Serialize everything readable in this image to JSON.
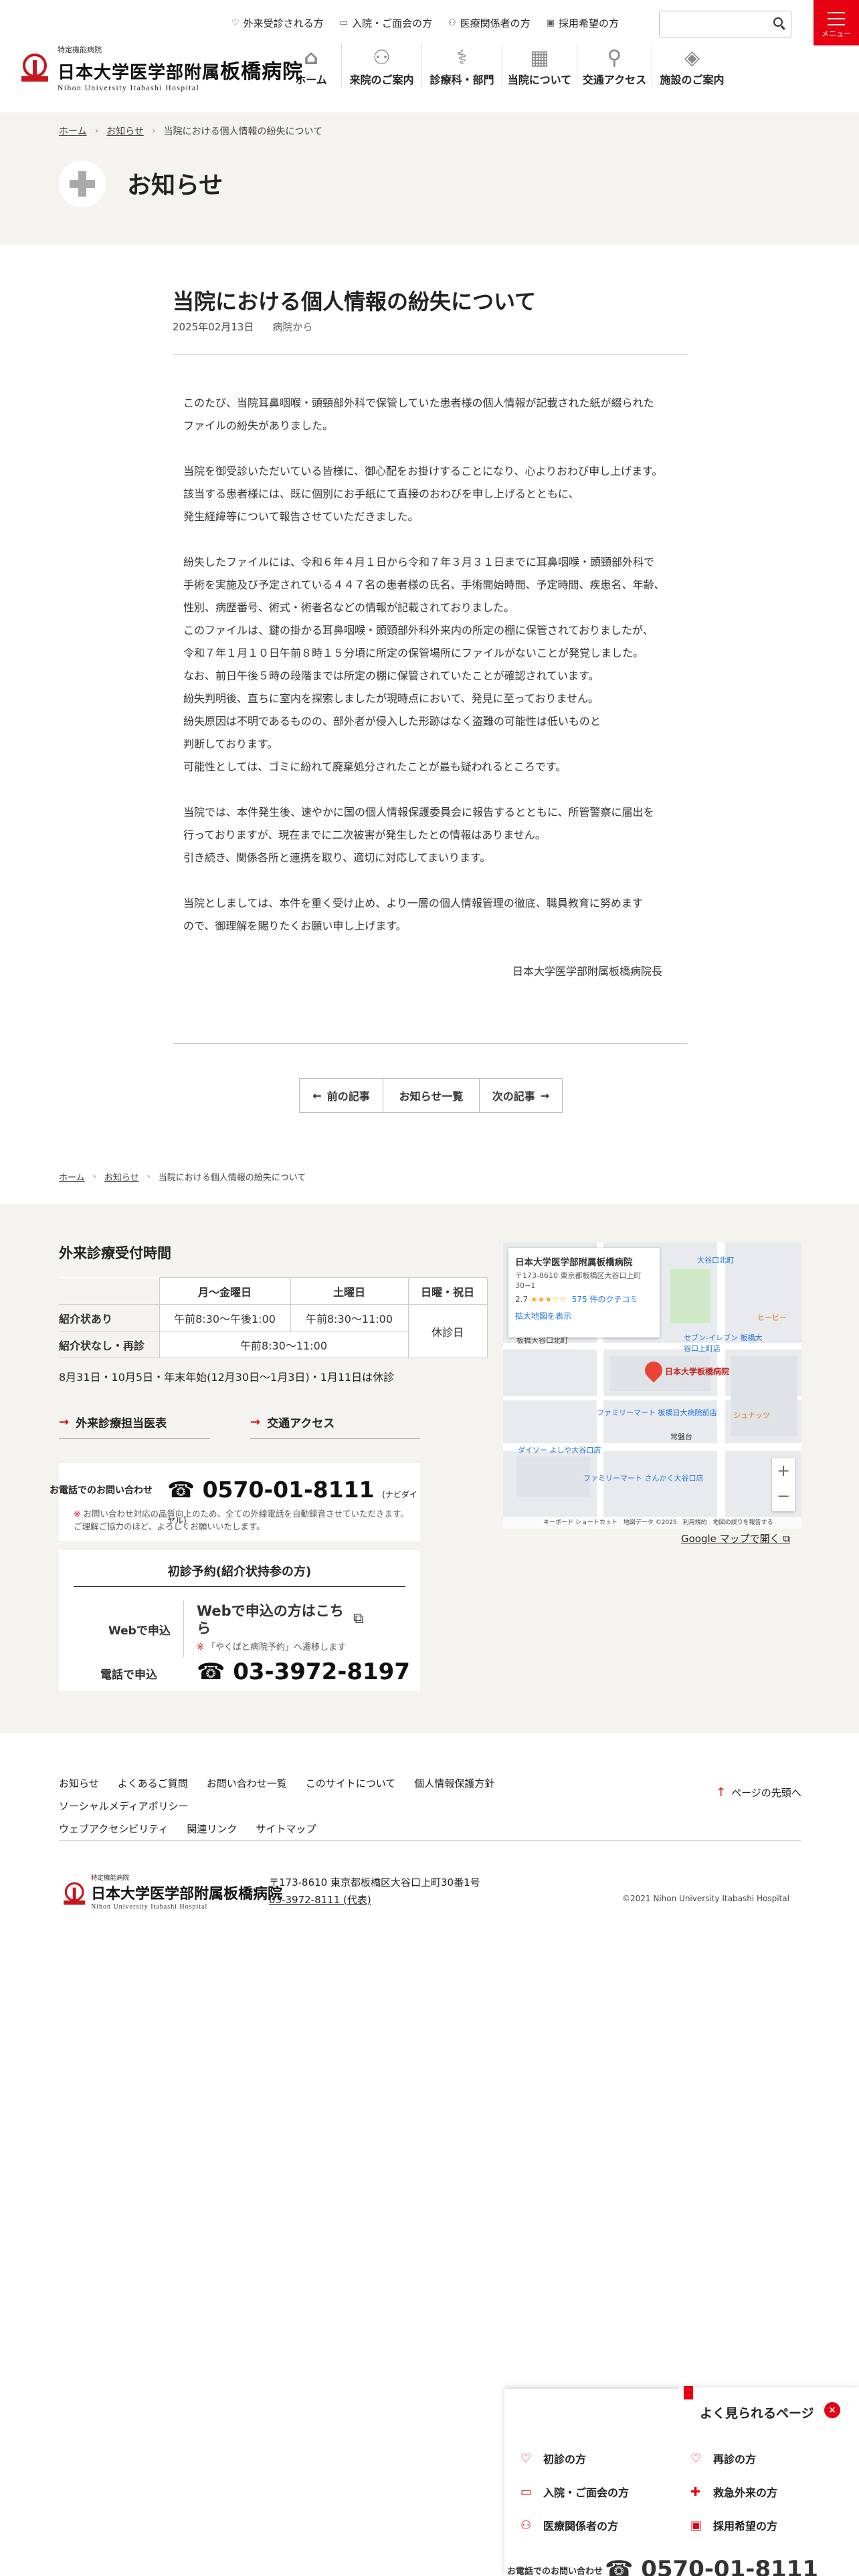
{
  "header": {
    "logo_small": "特定機能病院",
    "logo_main_prefix": "日本大学医学部附属",
    "logo_main_big": "板橋病院",
    "logo_en": "Nihon University Itabashi Hospital",
    "util_links": [
      {
        "icon": "stethoscope-icon",
        "glyph": "♡",
        "label": "外来受診される方"
      },
      {
        "icon": "bed-icon",
        "glyph": "▭",
        "label": "入院・ご面会の方"
      },
      {
        "icon": "person-icon",
        "glyph": "⚇",
        "label": "医療関係者の方"
      },
      {
        "icon": "id-card-icon",
        "glyph": "▣",
        "label": "採用希望の方"
      }
    ],
    "search_placeholder": "",
    "menu_label": "メニュー",
    "gnav": [
      {
        "icon": "home-icon",
        "glyph": "⌂",
        "label": "ホーム"
      },
      {
        "icon": "people-icon",
        "glyph": "⚇",
        "label": "来院のご案内"
      },
      {
        "icon": "doctor-icon",
        "glyph": "⚕",
        "label": "診療科・部門"
      },
      {
        "icon": "building-icon",
        "glyph": "▦",
        "label": "当院について"
      },
      {
        "icon": "map-pin-icon",
        "glyph": "⚲",
        "label": "交通アクセス"
      },
      {
        "icon": "layers-icon",
        "glyph": "◈",
        "label": "施設のご案内"
      }
    ]
  },
  "breadcrumb": {
    "home": "ホーム",
    "news": "お知らせ",
    "current": "当院における個人情報の紛失について",
    "sep": "›"
  },
  "page_title": "お知らせ",
  "article": {
    "title": "当院における個人情報の紛失について",
    "date": "2025年02月13日",
    "category": "病院から",
    "paragraphs": [
      "このたび、当院耳鼻咽喉・頭頸部外科で保管していた患者様の個人情報が記載された紙が綴られた\nファイルの紛失がありました。",
      "当院を御受診いただいている皆様に、御心配をお掛けすることになり、心よりおわび申し上げます。\n該当する患者様には、既に個別にお手紙にて直接のおわびを申し上げるとともに、\n発生経緯等について報告させていただきました。",
      "紛失したファイルには、令和６年４月１日から令和７年３月３１日までに耳鼻咽喉・頭頸部外科で\n手術を実施及び予定されている４４７名の患者様の氏名、手術開始時間、予定時間、疾患名、年齢、\n性別、病歴番号、術式・術者名などの情報が記載されておりました。\nこのファイルは、鍵の掛かる耳鼻咽喉・頭頸部外科外来内の所定の棚に保管されておりましたが、\n令和７年１月１０日午前８時１５分頃に所定の保管場所にファイルがないことが発覚しました。\nなお、前日午後５時の段階までは所定の棚に保管されていたことが確認されています。\n紛失判明後、直ちに室内を探索しましたが現時点において、発見に至っておりません。\n紛失原因は不明であるものの、部外者が侵入した形跡はなく盗難の可能性は低いものと\n判断しております。\n可能性としては、ゴミに紛れて廃棄処分されたことが最も疑われるところです。",
      "当院では、本件発生後、速やかに国の個人情報保護委員会に報告するとともに、所管警察に届出を\n行っておりますが、現在までに二次被害が発生したとの情報はありません。\n引き続き、関係各所と連携を取り、適切に対応してまいります。",
      "当院としましては、本件を重く受け止め、より一層の個人情報管理の徹底、職員教育に努めます\nので、御理解を賜りたくお願い申し上げます。"
    ],
    "signature": "日本大学医学部附属板橋病院長"
  },
  "pager": {
    "prev": "前の記事",
    "list": "お知らせ一覧",
    "next": "次の記事"
  },
  "hours": {
    "heading": "外来診療受付時間",
    "col_headers": [
      "月〜金曜日",
      "土曜日",
      "日曜・祝日"
    ],
    "rows": [
      {
        "label": "紹介状あり",
        "weekday": "午前8:30〜午後1:00",
        "saturday": "午前8:30〜11:00"
      },
      {
        "label": "紹介状なし・再診",
        "combined": "午前8:30〜11:00"
      }
    ],
    "holiday": "休診日",
    "note": "8月31日・10月5日・年末年始(12月30日〜1月3日)・1月11日は休診"
  },
  "links": {
    "schedule": "外来診療担当医表",
    "access": "交通アクセス"
  },
  "phone": {
    "label": "お電話でのお問い合わせ",
    "number": "0570-01-8111",
    "suffix": "(ナビダイヤル)",
    "note": "お問い合わせ対応の品質向上のため、全ての外線電話を自動録音させていただきます。ご理解ご協力のほど、よろしくお願いいたします。"
  },
  "first_visit": {
    "heading": "初診予約(紹介状持参の方)",
    "web_label": "Webで申込",
    "web_link": "Webで申込の方はこちら",
    "web_sub": "「やくばと病院予約」へ遷移します",
    "tel_label": "電話で申込",
    "tel_number": "03-3972-8197"
  },
  "map": {
    "name": "日本大学医学部附属板橋病院",
    "address": "〒173-8610 東京都板橋区大谷口上町30−1",
    "rating": "2.7",
    "stars": "★★★☆☆",
    "reviews": "575 件のクチコミ",
    "enlarge": "拡大地図を表示",
    "pin_label": "日本大学板橋病院",
    "labels": [
      "板橋大谷口北町",
      "ファミリーマート 板橋日大病院前店",
      "ダイソー よしや大谷口店",
      "ファミリーマート さんかく大谷口店",
      "常盤台",
      "セブン-イレブン 板橋大谷口上町店",
      "シュナッツ",
      "ヒービー",
      "大谷口北町"
    ],
    "footer": "キーボード ショートカット　地図データ ©2025　利用規約　地図の誤りを報告する",
    "open_link": "Google マップで開く"
  },
  "footer": {
    "nav": [
      "お知らせ",
      "よくあるご質問",
      "お問い合わせ一覧",
      "このサイトについて",
      "個人情報保護方針",
      "ソーシャルメディアポリシー",
      "ウェブアクセシビリティ",
      "関連リンク",
      "サイトマップ"
    ],
    "pagetop": "ページの先頭へ",
    "address": "〒173-8610 東京都板橋区大谷口上町30番1号",
    "tel": "03-3972-8111 (代表)",
    "copyright": "©2021 Nihon University Itabashi Hospital"
  },
  "float_panel": {
    "title": "よく見られるページ",
    "close": "×",
    "items": [
      {
        "icon": "stethoscope-icon",
        "glyph": "♡",
        "label": "初診の方"
      },
      {
        "icon": "stethoscope-icon",
        "glyph": "♡",
        "label": "再診の方"
      },
      {
        "icon": "bed-icon",
        "glyph": "▭",
        "label": "入院・ご面会の方"
      },
      {
        "icon": "ambulance-icon",
        "glyph": "✚",
        "label": "救急外来の方"
      },
      {
        "icon": "person-icon",
        "glyph": "⚇",
        "label": "医療関係者の方"
      },
      {
        "icon": "id-card-icon",
        "glyph": "▣",
        "label": "採用希望の方"
      }
    ],
    "phone_label": "お電話でのお問い合わせ",
    "phone_number": "0570-01-8111"
  },
  "colors": {
    "accent": "#e60012",
    "beige": "#f4f3ef",
    "text": "#333333"
  }
}
